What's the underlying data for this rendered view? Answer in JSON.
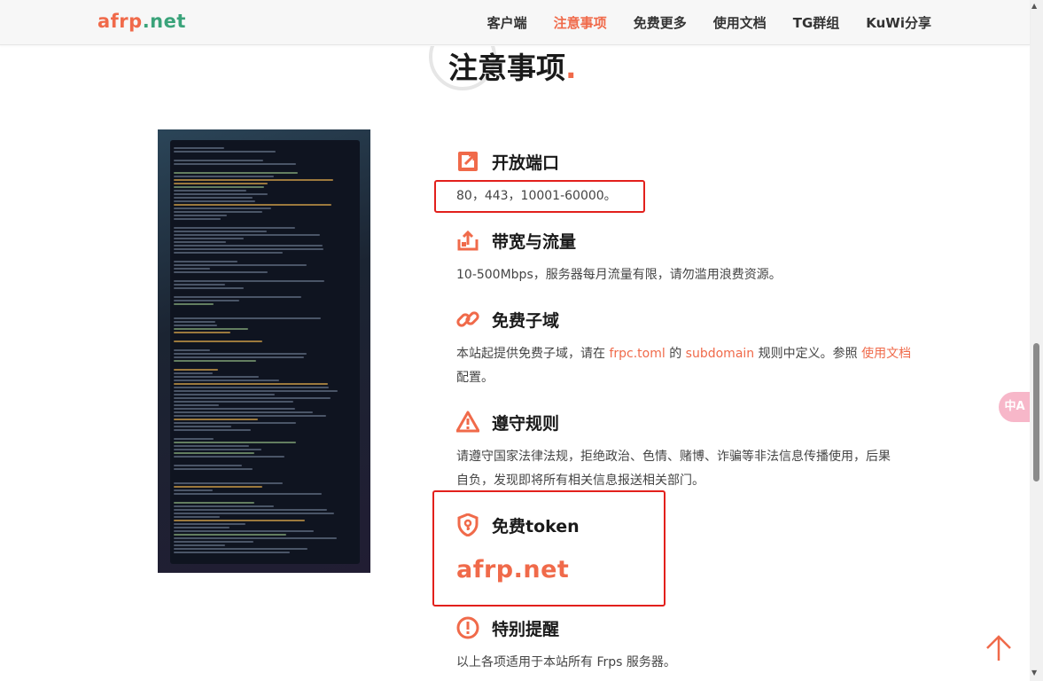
{
  "header": {
    "logo_part1": "afrp",
    "logo_part2": ".net",
    "nav": [
      "客户端",
      "注意事项",
      "免费更多",
      "使用文档",
      "TG群组",
      "KuWi分享"
    ],
    "active_index": 1
  },
  "page": {
    "title": "注意事项",
    "title_dot": "."
  },
  "sections": {
    "ports": {
      "title": "开放端口",
      "text": "80，443，10001-60000。"
    },
    "bandwidth": {
      "title": "带宽与流量",
      "text": "10-500Mbps，服务器每月流量有限，请勿滥用浪费资源。"
    },
    "subdomain": {
      "title": "免费子域",
      "text_a": "本站起提供免费子域，请在 ",
      "link_file": "frpc.toml",
      "text_b": " 的 ",
      "link_rule": "subdomain",
      "text_c": " 规则中定义。参照 ",
      "link_docs": "使用文档",
      "text_d": "配置。"
    },
    "rules": {
      "title": "遵守规则",
      "line1": "请遵守国家法律法规，拒绝政治、色情、赌博、诈骗等非法信息传播使用，后果",
      "line2": "自负，发现即将所有相关信息报送相关部门。"
    },
    "token": {
      "title": "免费token",
      "value": "afrp.net"
    },
    "notice": {
      "title": "特别提醒",
      "text": "以上各项适用于本站所有 Frps 服务器。"
    }
  },
  "widgets": {
    "translate_label": "中A"
  },
  "colors": {
    "accent": "#f06a4a",
    "logo_green": "#3aa37a",
    "highlight_box": "#e2201c"
  },
  "icons": [
    "external-link-icon",
    "upload-icon",
    "link-icon",
    "warning-icon",
    "shield-key-icon",
    "exclamation-circle-icon",
    "arrow-up-icon",
    "translate-icon"
  ]
}
